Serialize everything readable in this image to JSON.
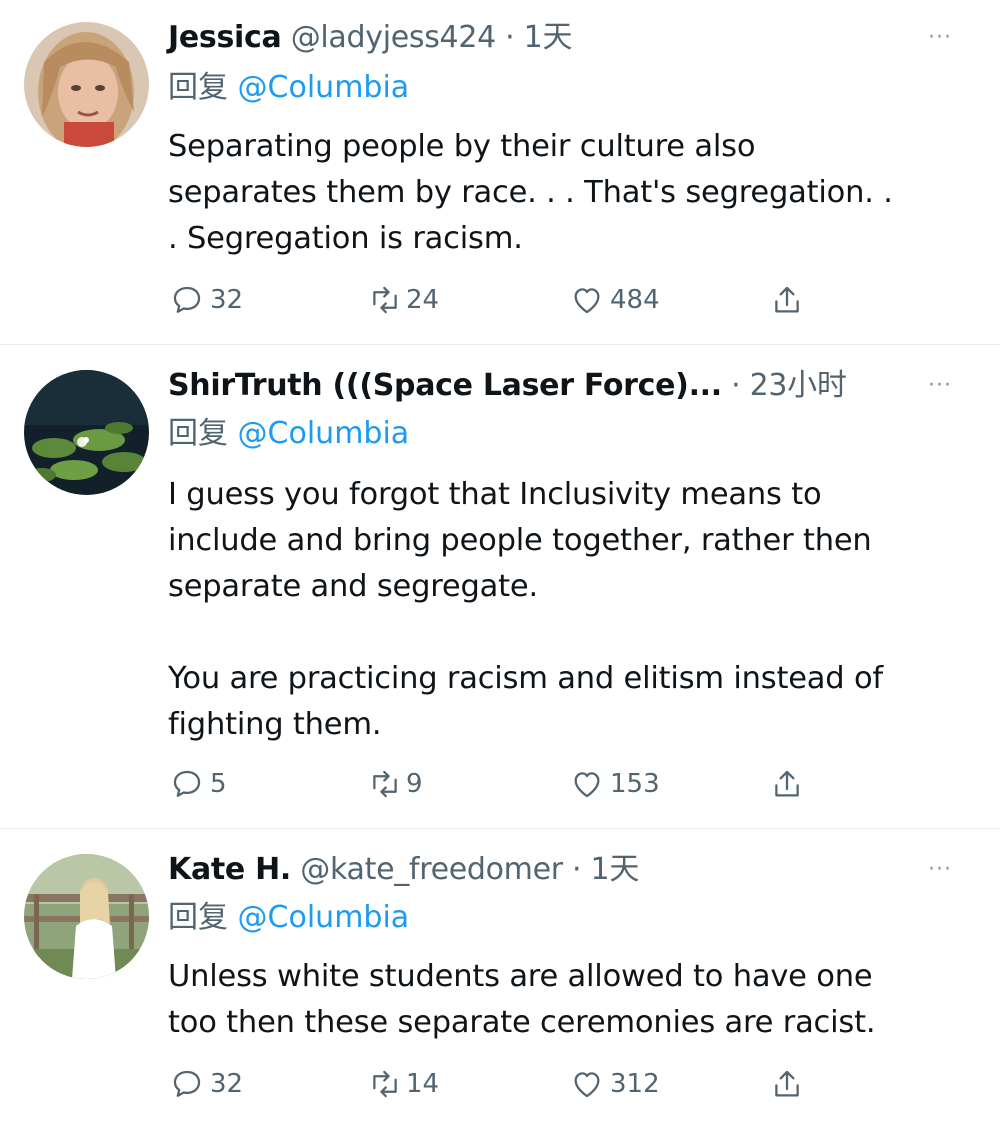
{
  "tweets": [
    {
      "name": "Jessica",
      "handle": "@ladyjess424",
      "separator": "·",
      "time": "1天",
      "reply_prefix": "回复",
      "reply_to": "@Columbia",
      "body_lines": [
        "Separating people by their culture also",
        "separates them by race. . . That's segregation. .",
        ". Segregation is racism."
      ],
      "replies": "32",
      "retweets": "24",
      "likes": "484",
      "more": "···"
    },
    {
      "name": "ShirTruth (((Space Laser Force)...",
      "handle": "",
      "separator": "·",
      "time": "23小时",
      "reply_prefix": "回复",
      "reply_to": "@Columbia",
      "body_lines": [
        "I guess you forgot that Inclusivity means to",
        "include and bring people together, rather then",
        "separate and segregate."
      ],
      "body_lines_2": [
        "You are practicing racism and elitism instead of",
        "fighting them."
      ],
      "replies": "5",
      "retweets": "9",
      "likes": "153",
      "more": "···"
    },
    {
      "name": "Kate H.",
      "handle": "@kate_freedomer",
      "separator": "·",
      "time": "1天",
      "reply_prefix": "回复",
      "reply_to": "@Columbia",
      "body_lines": [
        "Unless white students are allowed to have one",
        "too then these separate ceremonies are racist."
      ],
      "replies": "32",
      "retweets": "14",
      "likes": "312",
      "more": "···"
    }
  ],
  "icons": {
    "reply": "speech-bubble-icon",
    "retweet": "retweet-arrows-icon",
    "like": "heart-icon",
    "share": "share-upload-icon",
    "more": "more-dots-icon"
  },
  "colors": {
    "mention": "#1d9bf0",
    "muted": "#536471",
    "text": "#0f1419",
    "divider": "#e6ecf0"
  }
}
